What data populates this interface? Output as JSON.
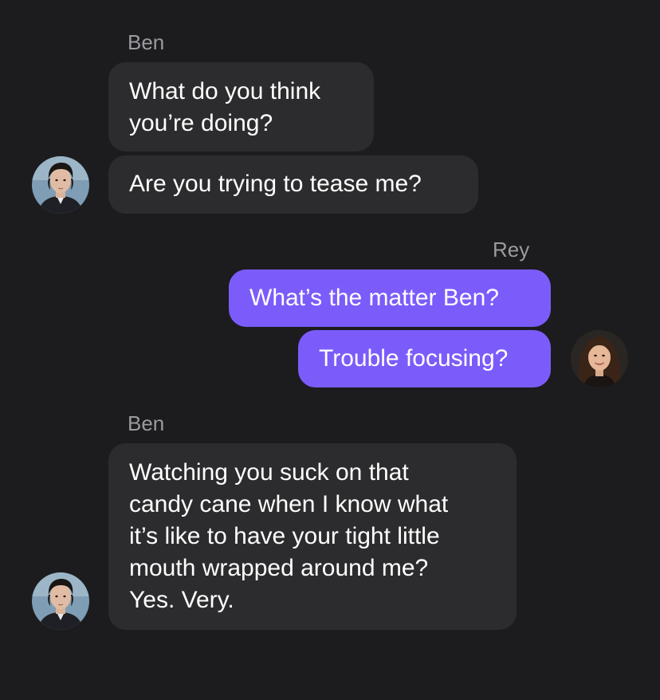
{
  "messages": [
    {
      "sender": "Ben",
      "direction": "incoming",
      "bubbles": [
        "What do you think\nyou’re doing?",
        "Are you trying to tease me?"
      ]
    },
    {
      "sender": "Rey",
      "direction": "outgoing",
      "bubbles": [
        "What’s the matter Ben?",
        "Trouble focusing?"
      ]
    },
    {
      "sender": "Ben",
      "direction": "incoming",
      "bubbles": [
        "Watching you suck on that\ncandy cane when I know what\nit’s like to have your tight little\nmouth wrapped around me?\nYes. Very."
      ]
    }
  ],
  "avatars": {
    "ben": "avatar-ben",
    "rey": "avatar-rey"
  },
  "colors": {
    "background": "#1c1c1e",
    "incoming_bubble": "#2c2c2e",
    "outgoing_bubble": "#7b5cfa",
    "sender_name": "#9a9aa0"
  }
}
